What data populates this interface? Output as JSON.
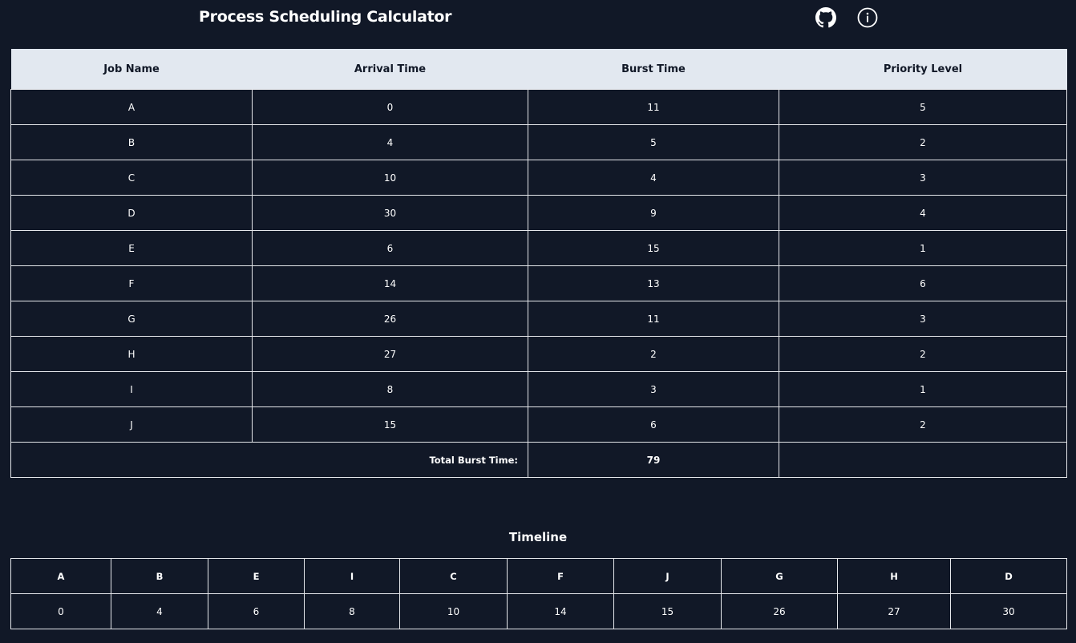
{
  "header": {
    "title": "Process Scheduling Calculator",
    "github_icon": "github-icon",
    "info_icon": "info-icon"
  },
  "jobs_table": {
    "columns": [
      "Job Name",
      "Arrival Time",
      "Burst Time",
      "Priority Level"
    ],
    "rows": [
      {
        "job": "A",
        "arrival": "0",
        "burst": "11",
        "priority": "5"
      },
      {
        "job": "B",
        "arrival": "4",
        "burst": "5",
        "priority": "2"
      },
      {
        "job": "C",
        "arrival": "10",
        "burst": "4",
        "priority": "3"
      },
      {
        "job": "D",
        "arrival": "30",
        "burst": "9",
        "priority": "4"
      },
      {
        "job": "E",
        "arrival": "6",
        "burst": "15",
        "priority": "1"
      },
      {
        "job": "F",
        "arrival": "14",
        "burst": "13",
        "priority": "6"
      },
      {
        "job": "G",
        "arrival": "26",
        "burst": "11",
        "priority": "3"
      },
      {
        "job": "H",
        "arrival": "27",
        "burst": "2",
        "priority": "2"
      },
      {
        "job": "I",
        "arrival": "8",
        "burst": "3",
        "priority": "1"
      },
      {
        "job": "J",
        "arrival": "15",
        "burst": "6",
        "priority": "2"
      }
    ],
    "total_label": "Total Burst Time:",
    "total_value": "79"
  },
  "timeline": {
    "title": "Timeline",
    "jobs": [
      "A",
      "B",
      "E",
      "I",
      "C",
      "F",
      "J",
      "G",
      "H",
      "D"
    ],
    "times": [
      "0",
      "4",
      "6",
      "8",
      "10",
      "14",
      "15",
      "26",
      "27",
      "30"
    ]
  },
  "colors": {
    "background": "#111827",
    "header_row": "#e2e8f0",
    "border": "#e5e7eb",
    "text": "#ffffff"
  }
}
